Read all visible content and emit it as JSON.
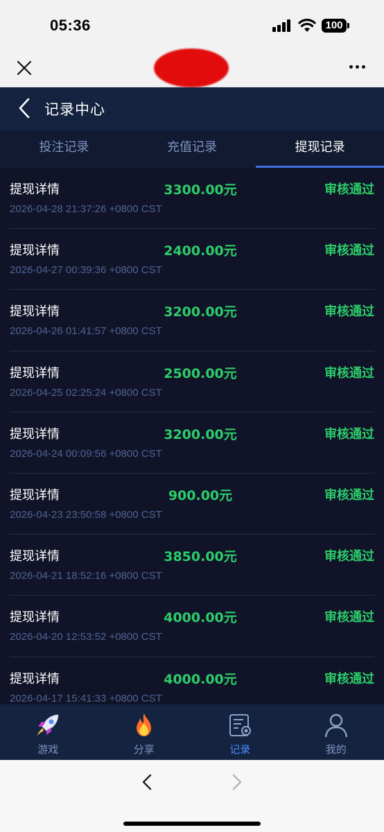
{
  "status_bar": {
    "time": "05:36",
    "battery": "100"
  },
  "header": {
    "title": "记录中心"
  },
  "tabs": [
    {
      "label": "投注记录",
      "active": false
    },
    {
      "label": "充值记录",
      "active": false
    },
    {
      "label": "提现记录",
      "active": true
    }
  ],
  "records": [
    {
      "label": "提现详情",
      "amount": "3300.00元",
      "status": "审核通过",
      "time": "2026-04-28 21:37:26 +0800 CST"
    },
    {
      "label": "提现详情",
      "amount": "2400.00元",
      "status": "审核通过",
      "time": "2026-04-27 00:39:36 +0800 CST"
    },
    {
      "label": "提现详情",
      "amount": "3200.00元",
      "status": "审核通过",
      "time": "2026-04-26 01:41:57 +0800 CST"
    },
    {
      "label": "提现详情",
      "amount": "2500.00元",
      "status": "审核通过",
      "time": "2026-04-25 02:25:24 +0800 CST"
    },
    {
      "label": "提现详情",
      "amount": "3200.00元",
      "status": "审核通过",
      "time": "2026-04-24 00:09:56 +0800 CST"
    },
    {
      "label": "提现详情",
      "amount": "900.00元",
      "status": "审核通过",
      "time": "2026-04-23 23:50:58 +0800 CST"
    },
    {
      "label": "提现详情",
      "amount": "3850.00元",
      "status": "审核通过",
      "time": "2026-04-21 18:52:16 +0800 CST"
    },
    {
      "label": "提现详情",
      "amount": "4000.00元",
      "status": "审核通过",
      "time": "2026-04-20 12:53:52 +0800 CST"
    },
    {
      "label": "提现详情",
      "amount": "4000.00元",
      "status": "审核通过",
      "time": "2026-04-17 15:41:33 +0800 CST"
    }
  ],
  "bottom_nav": [
    {
      "label": "游戏",
      "icon": "rocket-icon",
      "active": false
    },
    {
      "label": "分享",
      "icon": "flame-icon",
      "active": false
    },
    {
      "label": "记录",
      "icon": "records-icon",
      "active": true
    },
    {
      "label": "我的",
      "icon": "user-icon",
      "active": false
    }
  ],
  "colors": {
    "header_bg": "#14233f",
    "list_bg": "#111428",
    "accent_green": "#2ccd6a",
    "active_tab_indicator": "#3d6fe0",
    "nav_active": "#4c8cff"
  }
}
